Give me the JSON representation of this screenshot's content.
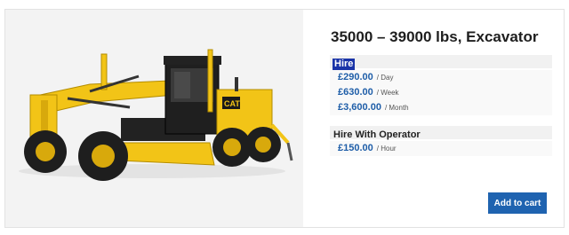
{
  "product": {
    "title": "35000 – 39000 lbs, Excavator",
    "image_alt": "Yellow motor grader with CAT logo",
    "image_logo_text": "CAT"
  },
  "hire": {
    "label": "Hire",
    "prices": [
      {
        "value": "£290.00",
        "unit": "/ Day"
      },
      {
        "value": "£630.00",
        "unit": "/ Week"
      },
      {
        "value": "£3,600.00",
        "unit": "/ Month"
      }
    ]
  },
  "hire_with_operator": {
    "label": "Hire With Operator",
    "prices": [
      {
        "value": "£150.00",
        "unit": "/ Hour"
      }
    ]
  },
  "actions": {
    "add_to_cart_label": "Add to cart"
  },
  "colors": {
    "accent_blue": "#1f63b0",
    "price_blue": "#1f5ea8",
    "hire_highlight": "#1a34a8",
    "machine_yellow": "#f2c417"
  }
}
